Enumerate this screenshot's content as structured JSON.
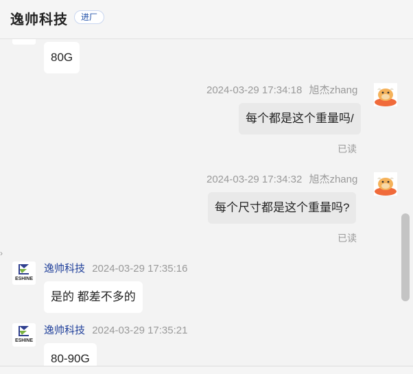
{
  "header": {
    "title": "逸帅科技",
    "tag": "进厂"
  },
  "messages": [
    {
      "text": "80G"
    },
    {
      "time": "2024-03-29 17:34:18",
      "sender": "旭杰zhang",
      "text": "每个都是这个重量吗/",
      "status": "已读"
    },
    {
      "time": "2024-03-29 17:34:32",
      "sender": "旭杰zhang",
      "text": "每个尺寸都是这个重量吗?",
      "status": "已读"
    },
    {
      "sender": "逸帅科技",
      "time": "2024-03-29 17:35:16",
      "text": "是的 都差不多的",
      "logo_text": "ESHINE"
    },
    {
      "sender": "逸帅科技",
      "time": "2024-03-29 17:35:21",
      "text": "80-90G",
      "logo_text": "ESHINE"
    }
  ],
  "colors": {
    "sender_link": "#1f3f9a",
    "outgoing_bubble": "#e9e9e9",
    "incoming_bubble": "#ffffff"
  },
  "icons": {
    "company_logo": "eshine-logo",
    "user_avatar": "cartoon-cow-avatar"
  }
}
